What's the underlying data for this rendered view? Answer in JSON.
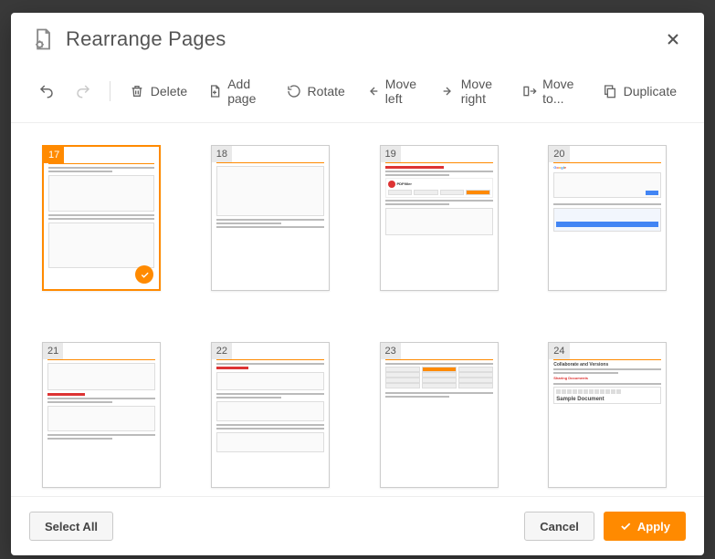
{
  "modal": {
    "title": "Rearrange Pages"
  },
  "toolbar": {
    "undo": "Undo",
    "redo": "Redo",
    "delete": "Delete",
    "add_page": "Add page",
    "rotate": "Rotate",
    "move_left": "Move left",
    "move_right": "Move right",
    "move_to": "Move to...",
    "duplicate": "Duplicate"
  },
  "pages": [
    {
      "num": "17",
      "selected": true,
      "kind": "sync"
    },
    {
      "num": "18",
      "selected": false,
      "kind": "generic"
    },
    {
      "num": "19",
      "selected": false,
      "kind": "cloud",
      "heading": "Documents from Cloud Storage"
    },
    {
      "num": "20",
      "selected": false,
      "kind": "google"
    },
    {
      "num": "21",
      "selected": false,
      "kind": "syncing",
      "heading": "Synchronizing"
    },
    {
      "num": "22",
      "selected": false,
      "kind": "generic2"
    },
    {
      "num": "23",
      "selected": false,
      "kind": "table"
    },
    {
      "num": "24",
      "selected": false,
      "kind": "collab",
      "heading": "Collaborate and Versions",
      "sub": "Sharing Documents",
      "sample": "Sample Document"
    }
  ],
  "footer": {
    "select_all": "Select All",
    "cancel": "Cancel",
    "apply": "Apply"
  }
}
